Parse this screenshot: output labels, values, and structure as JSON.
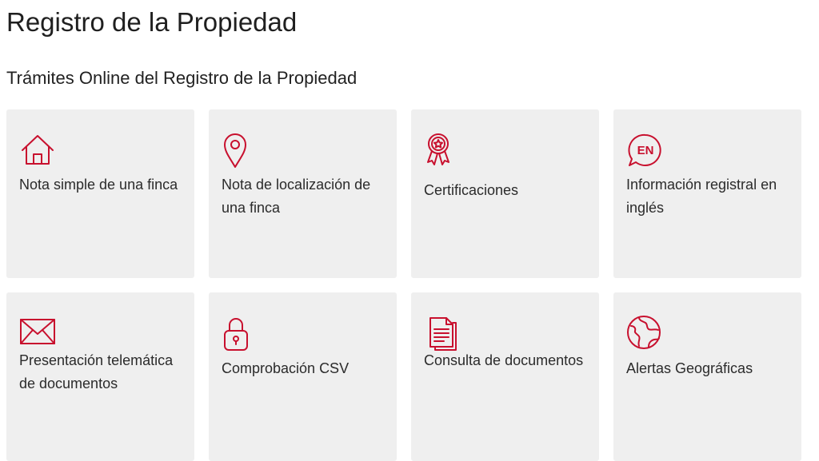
{
  "page": {
    "title": "Registro de la Propiedad",
    "section_title": "Trámites Online del Registro de la Propiedad"
  },
  "colors": {
    "accent": "#c8102e",
    "card_background": "#efefef",
    "text": "#2b2b2b"
  },
  "cards": [
    {
      "label": "Nota simple de una finca",
      "icon": "house-icon"
    },
    {
      "label": "Nota de localización de una finca",
      "icon": "location-pin-icon"
    },
    {
      "label": "Certificaciones",
      "icon": "award-ribbon-icon"
    },
    {
      "label": "Información registral en inglés",
      "icon": "english-speech-bubble-icon",
      "icon_text": "EN"
    },
    {
      "label": "Presentación telemática de documentos",
      "icon": "envelope-icon"
    },
    {
      "label": "Comprobación CSV",
      "icon": "padlock-icon"
    },
    {
      "label": "Consulta de documentos",
      "icon": "documents-icon"
    },
    {
      "label": "Alertas Geográficas",
      "icon": "globe-icon"
    }
  ]
}
